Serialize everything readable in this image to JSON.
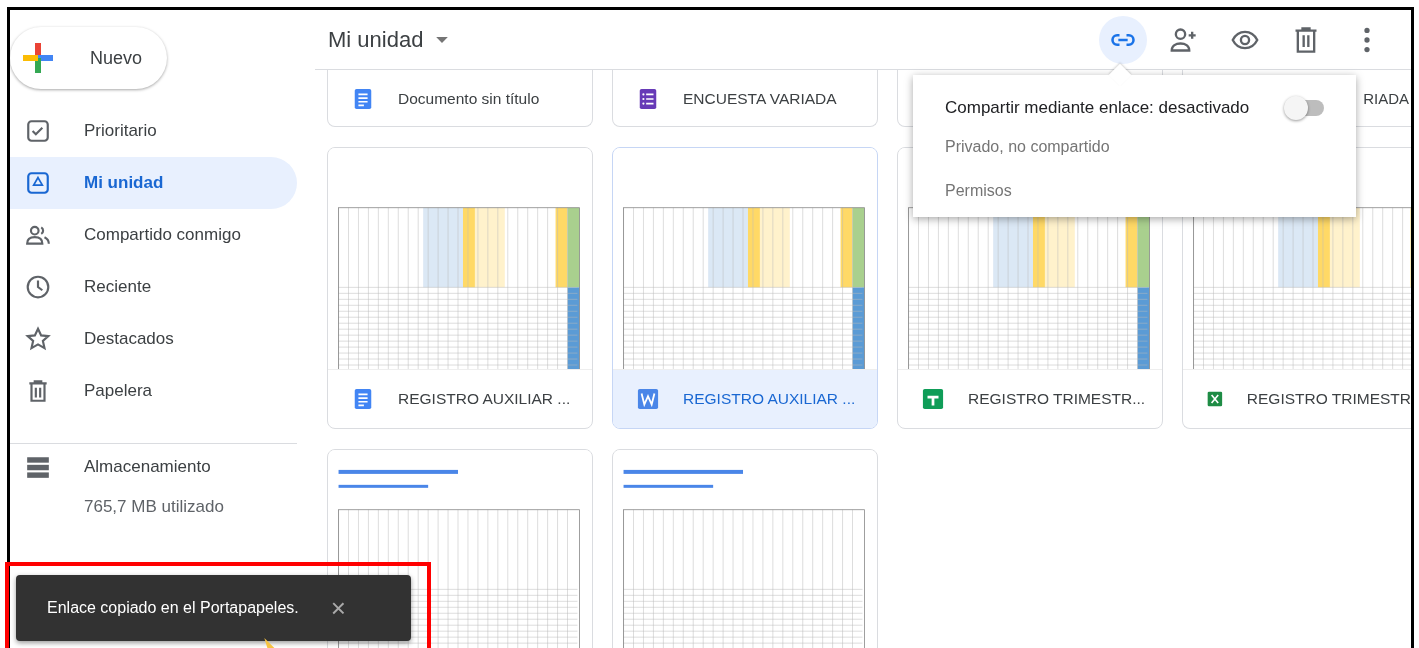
{
  "new_button": {
    "label": "Nuevo"
  },
  "sidebar": {
    "items": [
      {
        "label": "Prioritario",
        "selected": false
      },
      {
        "label": "Mi unidad",
        "selected": true
      },
      {
        "label": "Compartido conmigo",
        "selected": false
      },
      {
        "label": "Reciente",
        "selected": false
      },
      {
        "label": "Destacados",
        "selected": false
      },
      {
        "label": "Papelera",
        "selected": false
      }
    ],
    "storage": {
      "label": "Almacenamiento",
      "usage": "765,7 MB utilizado"
    }
  },
  "toolbar": {
    "title": "Mi unidad",
    "actions": [
      {
        "kind": "link",
        "selected": true
      },
      {
        "kind": "share",
        "selected": false
      },
      {
        "kind": "preview",
        "selected": false
      },
      {
        "kind": "delete",
        "selected": false
      },
      {
        "kind": "more",
        "selected": false
      }
    ]
  },
  "files": [
    {
      "kind": "docs",
      "title": "Documento sin título",
      "thumbnail": false,
      "selected": false
    },
    {
      "kind": "forms",
      "title": "ENCUESTA VARIADA",
      "thumbnail": false,
      "selected": false
    },
    {
      "kind": "blank",
      "thumbnail": false,
      "selected": false
    },
    {
      "kind": "blank",
      "title": "RIADA",
      "cut": true,
      "thumbnail": false,
      "selected": false
    },
    {
      "kind": "docs",
      "title": "REGISTRO AUXILIAR ...",
      "thumbnail": true,
      "selected": false
    },
    {
      "kind": "word",
      "title": "REGISTRO AUXILIAR ...",
      "thumbnail": true,
      "selected": true
    },
    {
      "kind": "sheets",
      "title": "REGISTRO TRIMESTR...",
      "thumbnail": true,
      "selected": false
    },
    {
      "kind": "excel",
      "title": "REGISTRO TRIMESTR",
      "thumbnail": true,
      "selected": false
    },
    {
      "kind": "preview",
      "thumbnail": true,
      "selected": false
    },
    {
      "kind": "preview",
      "thumbnail": true,
      "selected": false
    }
  ],
  "share_popup": {
    "title": "Compartir mediante enlace: desactivado",
    "on": false,
    "status": "Privado, no compartido",
    "link": "Permisos"
  },
  "toast": {
    "message": "Enlace copiado en el Portapapeles.",
    "close": "×"
  }
}
